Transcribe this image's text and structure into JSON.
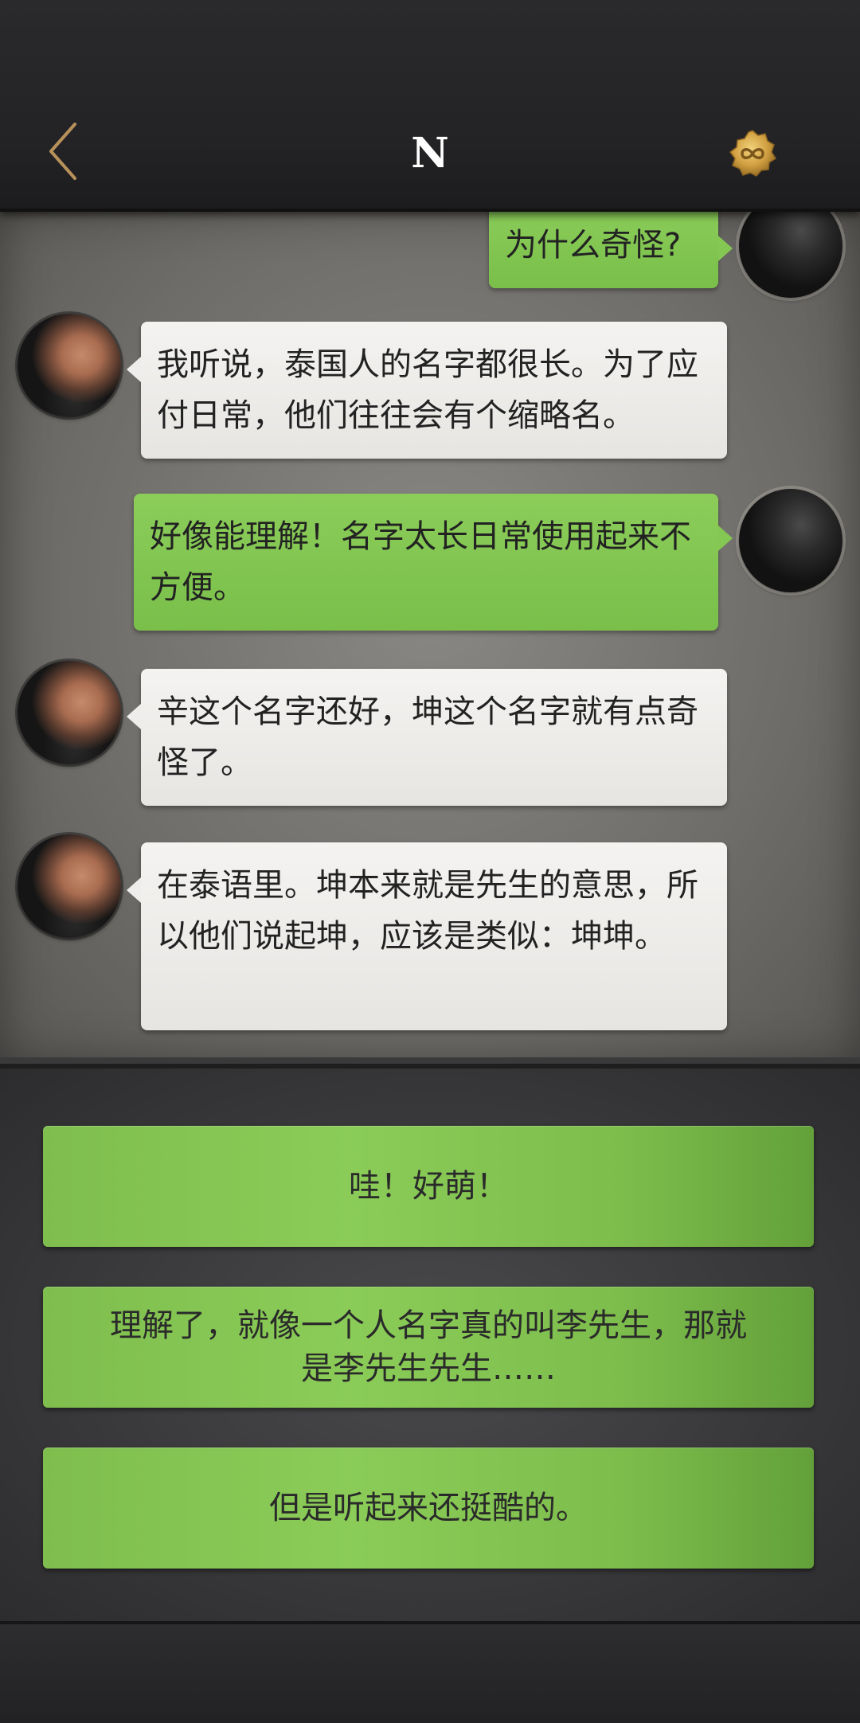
{
  "header": {
    "back_icon": "chevron-left-icon",
    "title": "N",
    "coin_icon": "infinity-coin-icon",
    "accent_color": "#b8915a"
  },
  "messages": [
    {
      "from": "user",
      "text": "为什么奇怪?"
    },
    {
      "from": "npc",
      "text": "我听说，泰国人的名字都很长。为了应付日常，他们往往会有个缩略名。"
    },
    {
      "from": "user",
      "text": "好像能理解！名字太长日常使用起来不方便。"
    },
    {
      "from": "npc",
      "text": "辛这个名字还好，坤这个名字就有点奇怪了。"
    },
    {
      "from": "npc",
      "text": "在泰语里。坤本来就是先生的意思，所以他们说起坤，应该是类似：坤坤。"
    }
  ],
  "options": [
    {
      "label": "哇！好萌！"
    },
    {
      "label": "理解了，就像一个人名字真的叫李先生，那就是李先生先生……"
    },
    {
      "label": "但是听起来还挺酷的。"
    }
  ],
  "colors": {
    "user_bubble": "#84c753",
    "npc_bubble": "#eeedeb",
    "option_green": "#8bcc58"
  }
}
